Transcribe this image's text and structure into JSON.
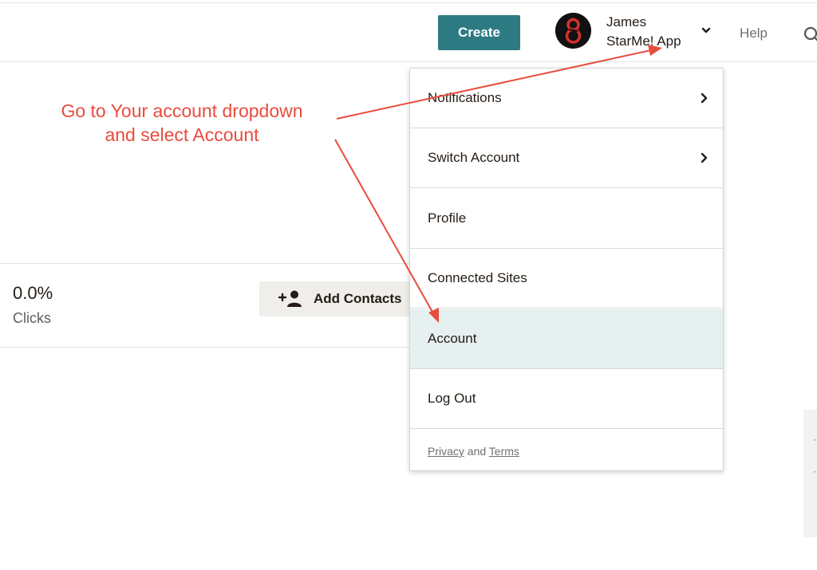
{
  "header": {
    "create_label": "Create",
    "account": {
      "name": "James",
      "org": "StarMe! App"
    },
    "help_label": "Help"
  },
  "stats": {
    "value": "0.0%",
    "label": "Clicks",
    "add_contacts_label": "Add Contacts"
  },
  "dropdown": {
    "items": [
      {
        "label": "Notifications",
        "has_submenu": true
      },
      {
        "label": "Switch Account",
        "has_submenu": true
      },
      {
        "label": "Profile",
        "has_submenu": false
      },
      {
        "label": "Connected Sites",
        "has_submenu": false
      },
      {
        "label": "Account",
        "has_submenu": false,
        "highlighted": true
      },
      {
        "label": "Log Out",
        "has_submenu": false
      }
    ],
    "footer": {
      "privacy_label": "Privacy",
      "and_label": "and",
      "terms_label": "Terms"
    }
  },
  "annotation": {
    "line1": "Go to Your account dropdown",
    "line2": "and select Account",
    "color": "#e84c3d"
  },
  "colors": {
    "primary_button": "#2d7a83",
    "highlight_row": "#e7f0f0",
    "secondary_button": "#efeeea"
  },
  "icons": {
    "avatar": "avatar-logo-icon",
    "account_chevron": "chevron-down-icon",
    "search": "search-icon",
    "submenu": "chevron-right-icon",
    "add_contacts": "add-person-icon"
  }
}
